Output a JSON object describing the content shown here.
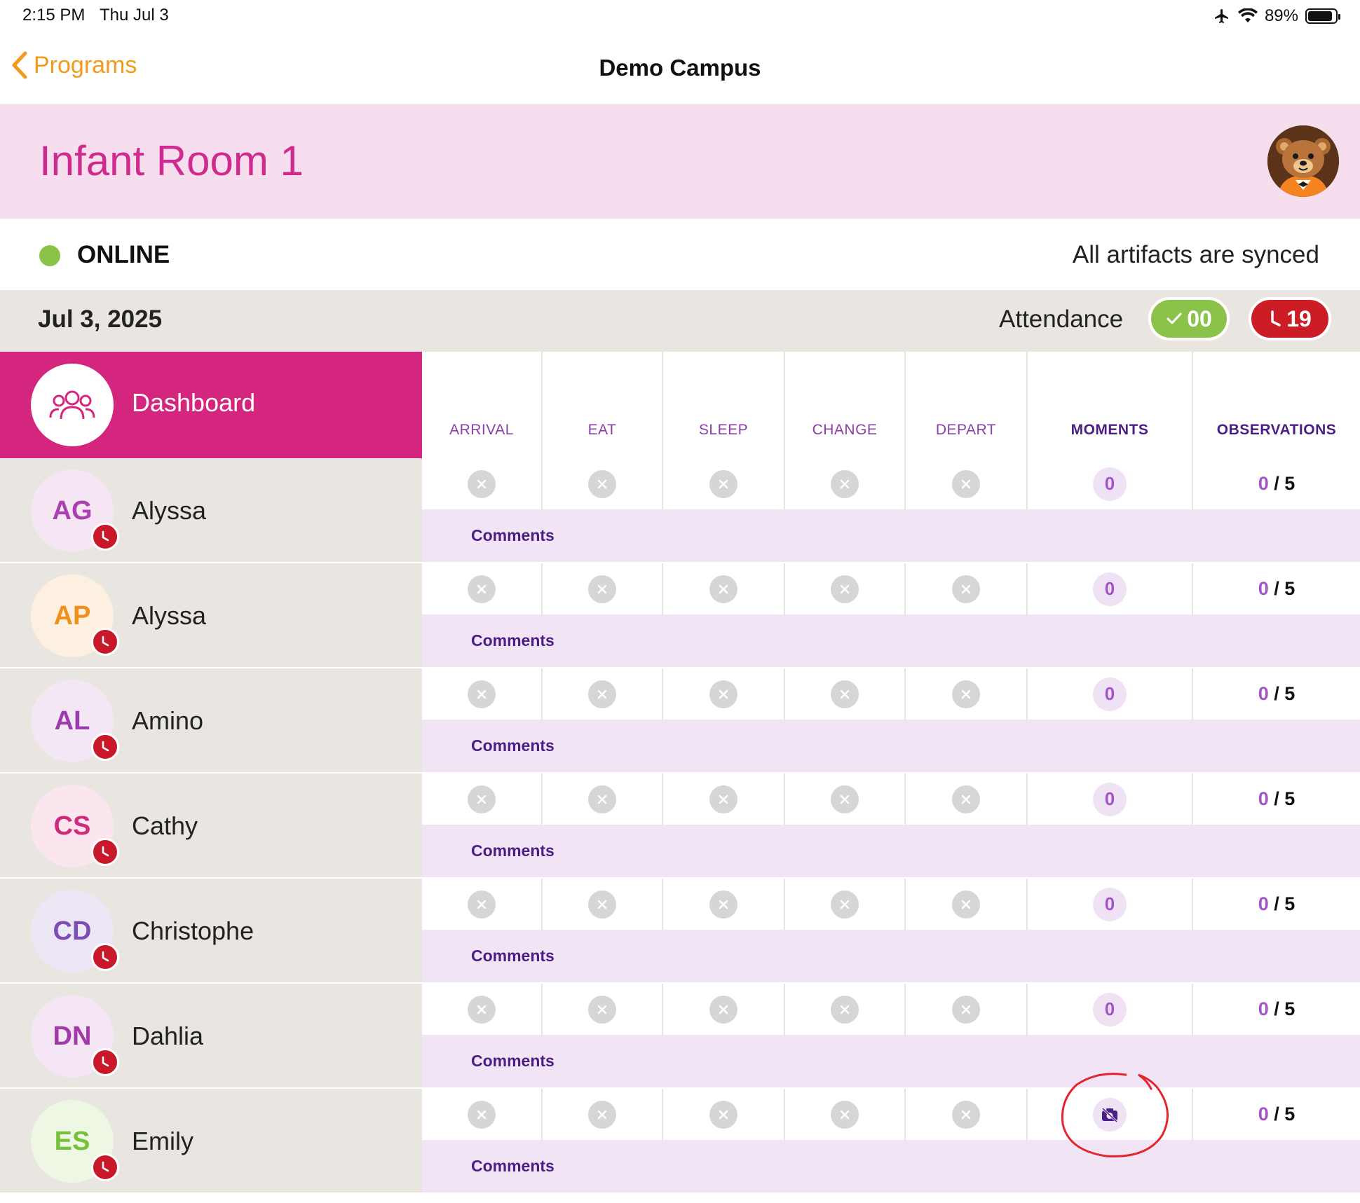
{
  "status_bar": {
    "time": "2:15 PM",
    "date": "Thu Jul 3",
    "battery": "89%"
  },
  "nav": {
    "back_label": "Programs",
    "title": "Demo Campus"
  },
  "room": {
    "title": "Infant Room 1"
  },
  "connection": {
    "status": "ONLINE",
    "sync_status": "All artifacts are synced"
  },
  "date_row": {
    "date": "Jul 3, 2025",
    "attendance_label": "Attendance",
    "present_count": "00",
    "absent_count": "19"
  },
  "dashboard": {
    "label": "Dashboard"
  },
  "columns": [
    "ARRIVAL",
    "EAT",
    "SLEEP",
    "CHANGE",
    "DEPART",
    "MOMENTS",
    "OBSERVATIONS"
  ],
  "comments_label": "Comments",
  "children": [
    {
      "initials": "AG",
      "name": "Alyssa",
      "moments": "0",
      "observations_done": "0",
      "observations_total": "5",
      "avatar_bg": "#f6e6f4",
      "avatar_fg": "#a93fb0"
    },
    {
      "initials": "AP",
      "name": "Alyssa",
      "moments": "0",
      "observations_done": "0",
      "observations_total": "5",
      "avatar_bg": "#fdf0e1",
      "avatar_fg": "#f0901c"
    },
    {
      "initials": "AL",
      "name": "Amino",
      "moments": "0",
      "observations_done": "0",
      "observations_total": "5",
      "avatar_bg": "#f3e7f5",
      "avatar_fg": "#9a3cad"
    },
    {
      "initials": "CS",
      "name": "Cathy",
      "moments": "0",
      "observations_done": "0",
      "observations_total": "5",
      "avatar_bg": "#fbe6ef",
      "avatar_fg": "#cf2b7c"
    },
    {
      "initials": "CD",
      "name": "Christophe",
      "moments": "0",
      "observations_done": "0",
      "observations_total": "5",
      "avatar_bg": "#ede7f5",
      "avatar_fg": "#7d4db5"
    },
    {
      "initials": "DN",
      "name": "Dahlia",
      "moments": "0",
      "observations_done": "0",
      "observations_total": "5",
      "avatar_bg": "#f4e6f4",
      "avatar_fg": "#a13aa8"
    },
    {
      "initials": "ES",
      "name": "Emily",
      "moments": "no-camera-icon",
      "observations_done": "0",
      "observations_total": "5",
      "avatar_bg": "#eef7e4",
      "avatar_fg": "#76c13a"
    }
  ],
  "icons": {
    "back": "chevron-left-icon",
    "dashboard": "people-group-icon",
    "late": "clock-icon",
    "status": "x-circle-icon",
    "moments_empty": "no-camera-icon"
  },
  "colors": {
    "accent": "#d4267f",
    "back_link": "#f29a1c",
    "online": "#8bc34a",
    "absent": "#cc1d27",
    "column_text": "#8b3ea6"
  }
}
